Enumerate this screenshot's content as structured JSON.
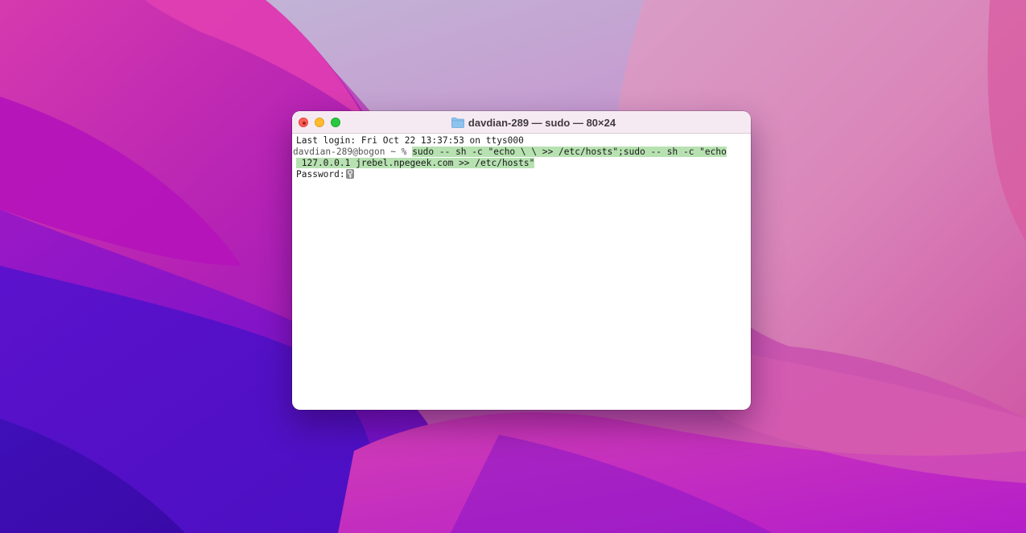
{
  "window": {
    "title": "davdian-289 — sudo — 80×24"
  },
  "terminal": {
    "last_login": "Last login: Fri Oct 22 13:37:53 on ttys000",
    "prompt": "davdian-289@bogon ~ % ",
    "command_line1": "sudo -- sh -c \"echo \\ \\ >> /etc/hosts\";sudo -- sh -c \"echo",
    "command_line2": " 127.0.0.1 jrebel.npegeek.com >> /etc/hosts\"",
    "password_prompt": "Password:"
  },
  "icons": {
    "title_folder": "folder-icon",
    "password_key": "key-icon"
  },
  "colors": {
    "selection": "#b7e1b1",
    "close": "#ff5f57",
    "minimize": "#febc2e",
    "maximize": "#28c840"
  }
}
